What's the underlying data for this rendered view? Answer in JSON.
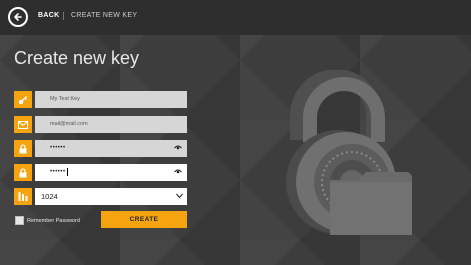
{
  "topbar": {
    "back_label": "BACK",
    "separator": "|",
    "breadcrumb": "CREATE NEW KEY"
  },
  "page": {
    "title": "Create new key"
  },
  "form": {
    "name": {
      "value": "My Test Key",
      "icon": "key-icon"
    },
    "email": {
      "value": "mail@mail.com",
      "icon": "envelope-icon"
    },
    "password": {
      "value": "••••••",
      "icon": "lock-icon"
    },
    "password_confirm": {
      "value": "••••••",
      "icon": "lock-icon"
    },
    "key_size": {
      "value": "1024",
      "icon": "bars-icon"
    },
    "remember_label": "Remember Password",
    "remember_checked": false,
    "create_label": "CREATE"
  },
  "colors": {
    "accent": "#f5a40f",
    "background": "#3d3d3d",
    "topbar": "#2e2e2e"
  }
}
